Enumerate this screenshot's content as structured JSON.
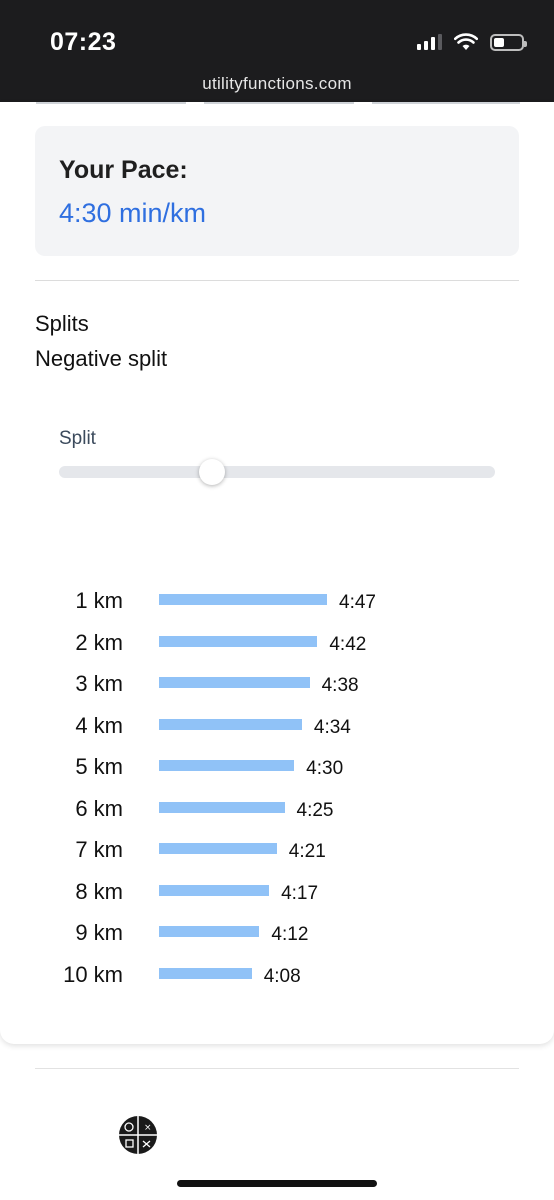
{
  "status_bar": {
    "time": "07:23",
    "url": "utilityfunctions.com",
    "icons": [
      "cellular-signal-icon",
      "wifi-icon",
      "battery-icon"
    ]
  },
  "pace": {
    "label": "Your Pace:",
    "value": "4:30 min/km",
    "value_color": "#2f6fe0"
  },
  "splits": {
    "title": "Splits",
    "mode": "Negative split",
    "slider": {
      "label": "Split",
      "value_fraction": 0.35
    },
    "bar_color": "#90c2f7",
    "rows": [
      {
        "km": "1 km",
        "time": "4:47",
        "seconds": 287
      },
      {
        "km": "2 km",
        "time": "4:42",
        "seconds": 282
      },
      {
        "km": "3 km",
        "time": "4:38",
        "seconds": 278
      },
      {
        "km": "4 km",
        "time": "4:34",
        "seconds": 274
      },
      {
        "km": "5 km",
        "time": "4:30",
        "seconds": 270
      },
      {
        "km": "6 km",
        "time": "4:25",
        "seconds": 265
      },
      {
        "km": "7 km",
        "time": "4:21",
        "seconds": 261
      },
      {
        "km": "8 km",
        "time": "4:17",
        "seconds": 257
      },
      {
        "km": "9 km",
        "time": "4:12",
        "seconds": 252
      },
      {
        "km": "10 km",
        "time": "4:08",
        "seconds": 248
      }
    ]
  },
  "footer": {
    "logo_icon": "site-logo-icon"
  }
}
